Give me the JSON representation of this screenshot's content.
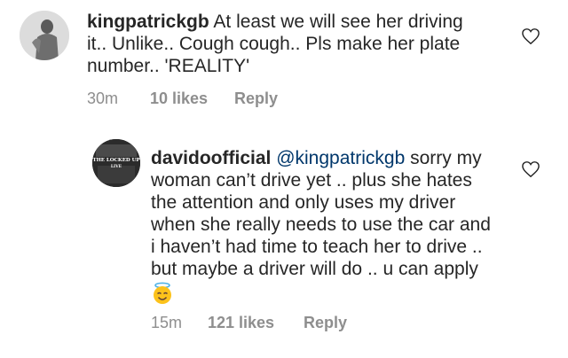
{
  "comments": [
    {
      "username": "kingpatrickgb",
      "text_lines": [
        "At least we will see her driving",
        "it.. Unlike.. Cough cough.. Pls make her plate",
        "number.. 'REALITY'"
      ],
      "time": "30m",
      "likes": "10 likes",
      "reply": "Reply"
    },
    {
      "username": "davidoofficial",
      "mention": "@kingpatrickgb",
      "text_lines": [
        "sorry my",
        "woman can’t drive yet .. plus she hates",
        "the attention and only uses my driver",
        "when she really needs to use the car and",
        "i haven’t had time to teach her to drive ..",
        "but maybe a driver will do .. u can apply"
      ],
      "emoji": "smiling-face-with-halo",
      "avatar_text": [
        "THE LOCKED UP",
        "LIVE"
      ],
      "time": "15m",
      "likes": "121 likes",
      "reply": "Reply"
    }
  ]
}
